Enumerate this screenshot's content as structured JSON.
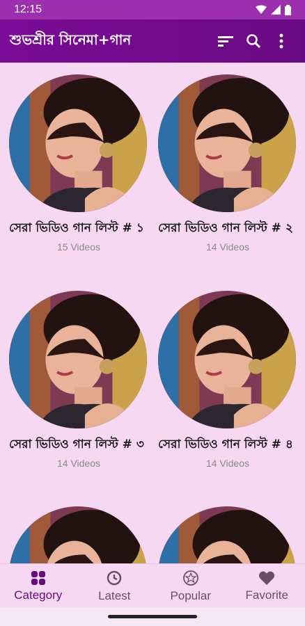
{
  "status": {
    "time": "12:15"
  },
  "app": {
    "title": "শুভশ্রীর সিনেমা+গান"
  },
  "items": [
    {
      "title": "সেরা ভিডিও গান লিস্ট # ১",
      "count": "15 Videos"
    },
    {
      "title": "সেরা ভিডিও গান লিস্ট # ২",
      "count": "14 Videos"
    },
    {
      "title": "সেরা ভিডিও গান লিস্ট # ৩",
      "count": "14 Videos"
    },
    {
      "title": "সেরা ভিডিও গান লিস্ট # ৪",
      "count": "14 Videos"
    },
    {
      "title": "",
      "count": ""
    },
    {
      "title": "",
      "count": ""
    }
  ],
  "nav": {
    "category": "Category",
    "latest": "Latest",
    "popular": "Popular",
    "favorite": "Favorite"
  },
  "colors": {
    "appbar": "#7a0b97",
    "background": "#f7d8f3",
    "accent": "#6a0a83"
  }
}
